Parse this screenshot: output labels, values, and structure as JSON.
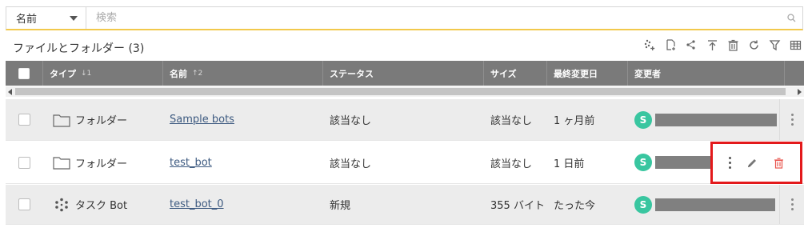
{
  "search": {
    "field_selected": "名前",
    "placeholder": "検索"
  },
  "section": {
    "title": "ファイルとフォルダー (3)"
  },
  "toolbar": {
    "icons": [
      "new-bot-icon",
      "new-file-icon",
      "share-icon",
      "upload-icon",
      "delete-icon",
      "refresh-icon",
      "filter-icon",
      "columns-icon"
    ]
  },
  "table": {
    "columns": [
      {
        "label": "タイプ",
        "sort": "↓1"
      },
      {
        "label": "名前",
        "sort": "↑2"
      },
      {
        "label": "ステータス",
        "sort": ""
      },
      {
        "label": "サイズ",
        "sort": ""
      },
      {
        "label": "最終変更日",
        "sort": ""
      },
      {
        "label": "変更者",
        "sort": ""
      }
    ],
    "rows": [
      {
        "type": "フォルダー",
        "name": "Sample bots",
        "status": "該当なし",
        "size": "該当なし",
        "modified": "1 ヶ月前",
        "avatar": "S"
      },
      {
        "type": "フォルダー",
        "name": "test_bot",
        "status": "該当なし",
        "size": "該当なし",
        "modified": "1 日前",
        "avatar": "S"
      },
      {
        "type": "タスク Bot",
        "name": "test_bot_0",
        "status": "新規",
        "size": "355 バイト",
        "modified": "たった今",
        "avatar": "S"
      }
    ]
  },
  "colors": {
    "header_bg": "#7a7a7a",
    "avatar": "#39c6a0",
    "highlight_box": "#e3191b",
    "delete_icon": "#e8554e",
    "search_underline": "#f2c94c"
  }
}
